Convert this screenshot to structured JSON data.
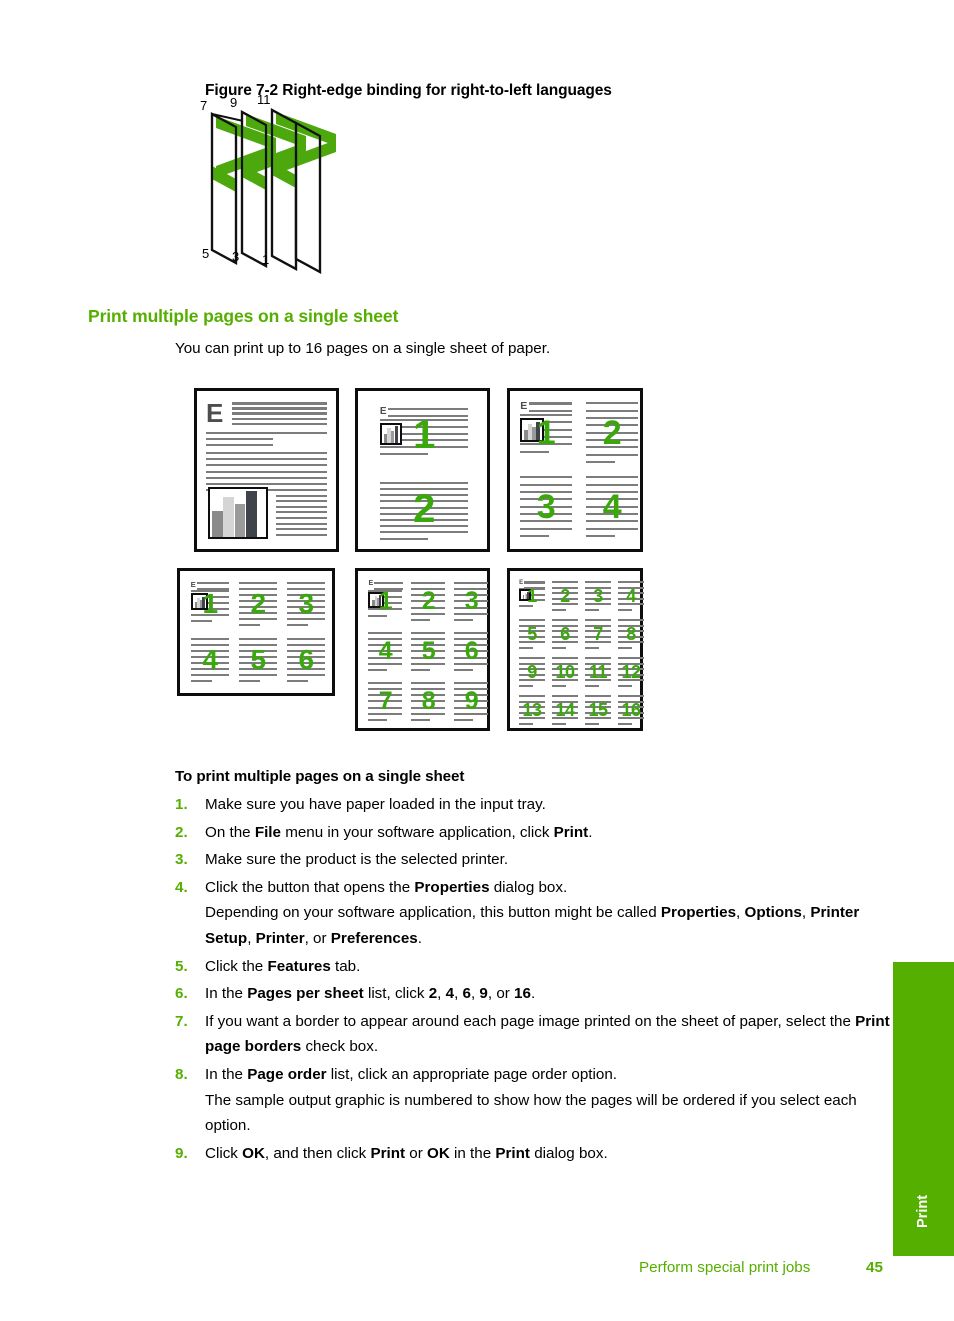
{
  "figure": {
    "caption": "Figure 7-2 Right-edge binding for right-to-left languages",
    "top_labels": [
      "7",
      "9",
      "11"
    ],
    "bottom_labels": [
      "5",
      "3",
      "1"
    ],
    "accent_color": "#4ca80c"
  },
  "section": {
    "heading": "Print multiple pages on a single sheet",
    "heading_color": "#55af00",
    "intro": "You can print up to 16 pages on a single sheet of paper."
  },
  "thumbnails": {
    "dropcap_letter": "E",
    "number_color": "#3aa80c",
    "layouts": [
      {
        "name": "1-up",
        "columns": 1,
        "rows": 1,
        "numbers": []
      },
      {
        "name": "2-up",
        "columns": 1,
        "rows": 2,
        "numbers": [
          "1",
          "2"
        ]
      },
      {
        "name": "4-up",
        "columns": 2,
        "rows": 2,
        "numbers": [
          "1",
          "2",
          "3",
          "4"
        ]
      },
      {
        "name": "6-up",
        "columns": 3,
        "rows": 2,
        "numbers": [
          "1",
          "2",
          "3",
          "4",
          "5",
          "6"
        ]
      },
      {
        "name": "9-up",
        "columns": 3,
        "rows": 3,
        "numbers": [
          "1",
          "2",
          "3",
          "4",
          "5",
          "6",
          "7",
          "8",
          "9"
        ]
      },
      {
        "name": "16-up",
        "columns": 4,
        "rows": 4,
        "numbers": [
          "1",
          "2",
          "3",
          "4",
          "5",
          "6",
          "7",
          "8",
          "9",
          "10",
          "11",
          "12",
          "13",
          "14",
          "15",
          "16"
        ]
      }
    ]
  },
  "procedure": {
    "heading": "To print multiple pages on a single sheet",
    "steps": [
      {
        "num": "1.",
        "html": "Make sure you have paper loaded in the input tray."
      },
      {
        "num": "2.",
        "html": "On the <b>File</b> menu in your software application, click <b>Print</b>."
      },
      {
        "num": "3.",
        "html": "Make sure the product is the selected printer."
      },
      {
        "num": "4.",
        "html": "Click the button that opens the <b>Properties</b> dialog box.",
        "sub": "Depending on your software application, this button might be called <b>Properties</b>, <b>Options</b>, <b>Printer Setup</b>, <b>Printer</b>, or <b>Preferences</b>."
      },
      {
        "num": "5.",
        "html": "Click the <b>Features</b> tab."
      },
      {
        "num": "6.",
        "html": "In the <b>Pages per sheet</b> list, click <b>2</b>, <b>4</b>, <b>6</b>, <b>9</b>, or <b>16</b>."
      },
      {
        "num": "7.",
        "html": "If you want a border to appear around each page image printed on the sheet of paper, select the <b>Print page borders</b> check box."
      },
      {
        "num": "8.",
        "html": "In the <b>Page order</b> list, click an appropriate page order option.",
        "sub": "The sample output graphic is numbered to show how the pages will be ordered if you select each option."
      },
      {
        "num": "9.",
        "html": "Click <b>OK</b>, and then click <b>Print</b> or <b>OK</b> in the <b>Print</b> dialog box."
      }
    ]
  },
  "side_tab": {
    "label": "Print",
    "color": "#55af00"
  },
  "footer": {
    "title": "Perform special print jobs",
    "page_number": "45",
    "color": "#55af00"
  }
}
